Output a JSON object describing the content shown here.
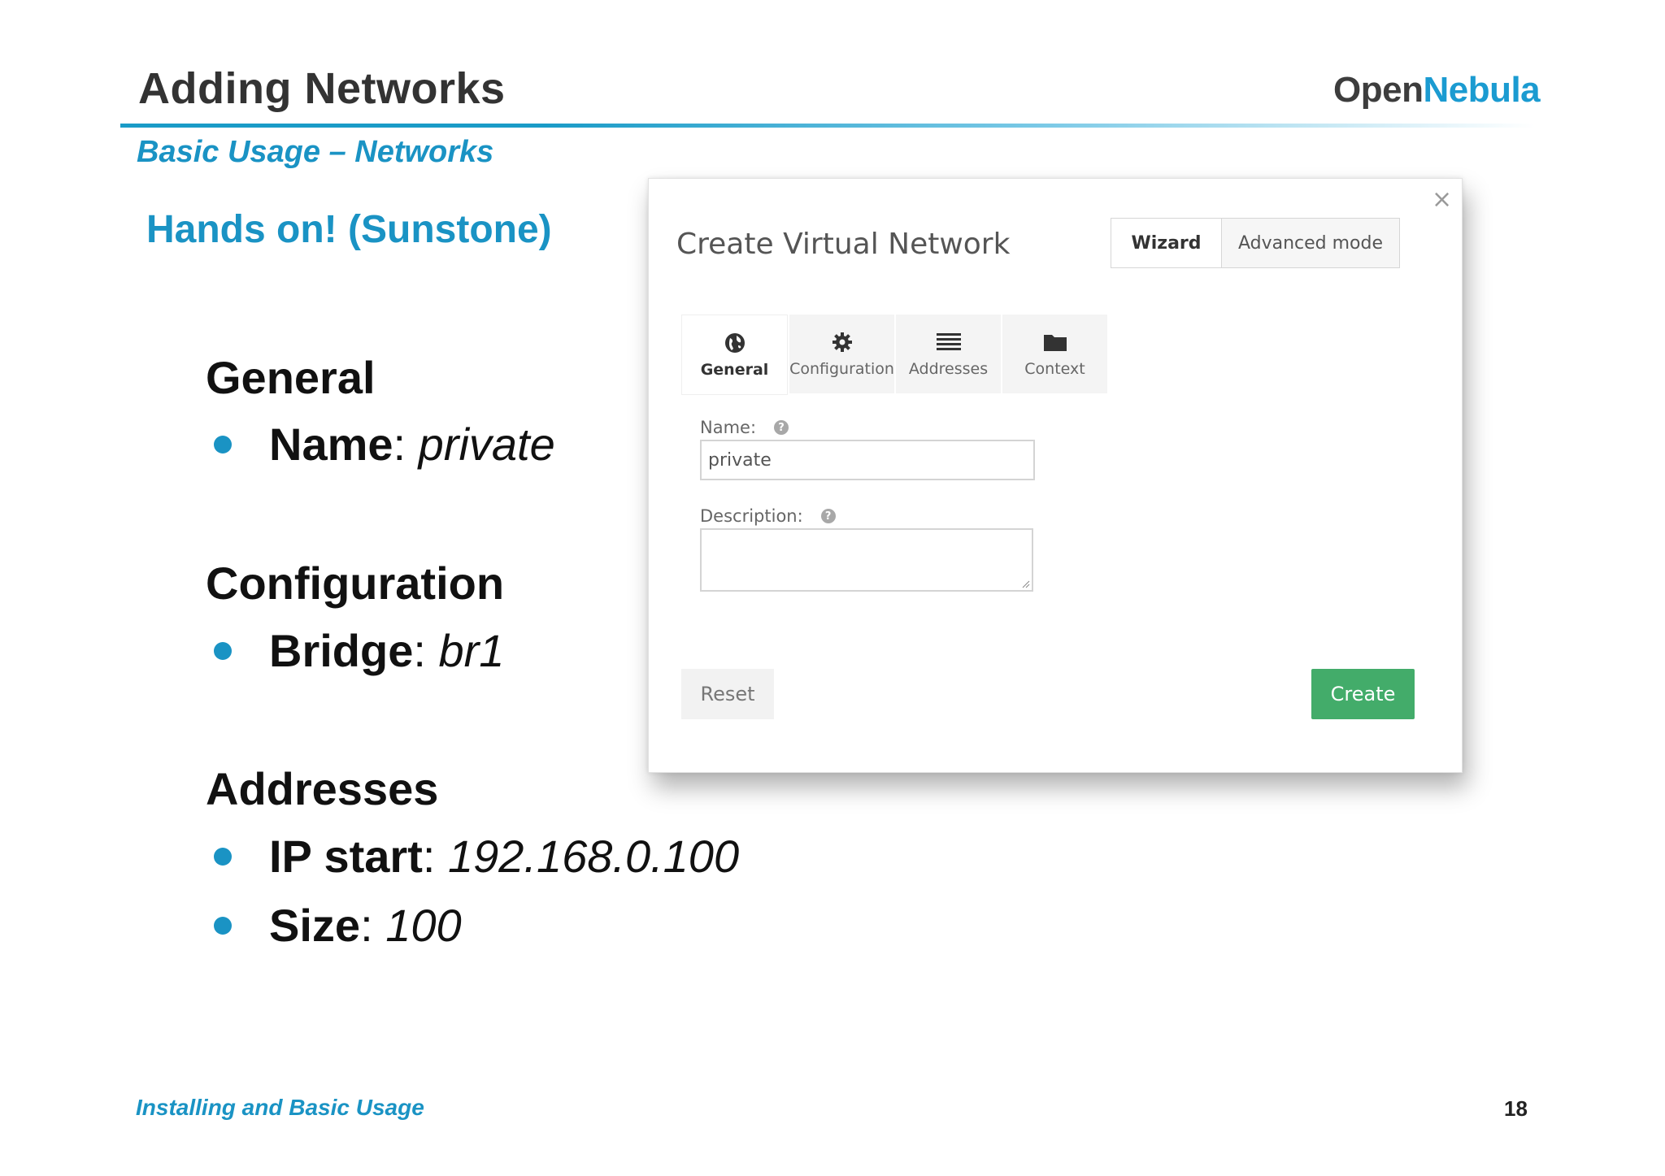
{
  "slide": {
    "title": "Adding Networks",
    "subtitle": "Basic Usage – Networks",
    "hands_on": "Hands on! (Sunstone)",
    "logo": {
      "part1": "Open",
      "part2": "Nebula"
    },
    "sections": [
      {
        "heading": "General",
        "items": [
          {
            "key": "Name",
            "value": "private"
          }
        ]
      },
      {
        "heading": "Configuration",
        "items": [
          {
            "key": "Bridge",
            "value": "br1"
          }
        ]
      },
      {
        "heading": "Addresses",
        "items": [
          {
            "key": "IP start",
            "value": "192.168.0.100"
          },
          {
            "key": "Size",
            "value": "100"
          }
        ]
      }
    ],
    "footer": "Installing and Basic Usage",
    "page_number": "18"
  },
  "dialog": {
    "close": "×",
    "title": "Create Virtual Network",
    "modes": {
      "wizard": "Wizard",
      "advanced": "Advanced mode"
    },
    "tabs": [
      {
        "label": "General",
        "icon": "globe-icon"
      },
      {
        "label": "Configuration",
        "icon": "gear-icon"
      },
      {
        "label": "Addresses",
        "icon": "list-icon"
      },
      {
        "label": "Context",
        "icon": "folder-icon"
      }
    ],
    "fields": {
      "name": {
        "label": "Name:",
        "value": "private"
      },
      "description": {
        "label": "Description:",
        "value": ""
      }
    },
    "help_glyph": "?",
    "buttons": {
      "reset": "Reset",
      "create": "Create"
    }
  },
  "colors": {
    "accent": "#1a93c4",
    "create": "#43ac6a",
    "logo_dark": "#3d3d3d",
    "logo_blue": "#1b9bd1"
  }
}
